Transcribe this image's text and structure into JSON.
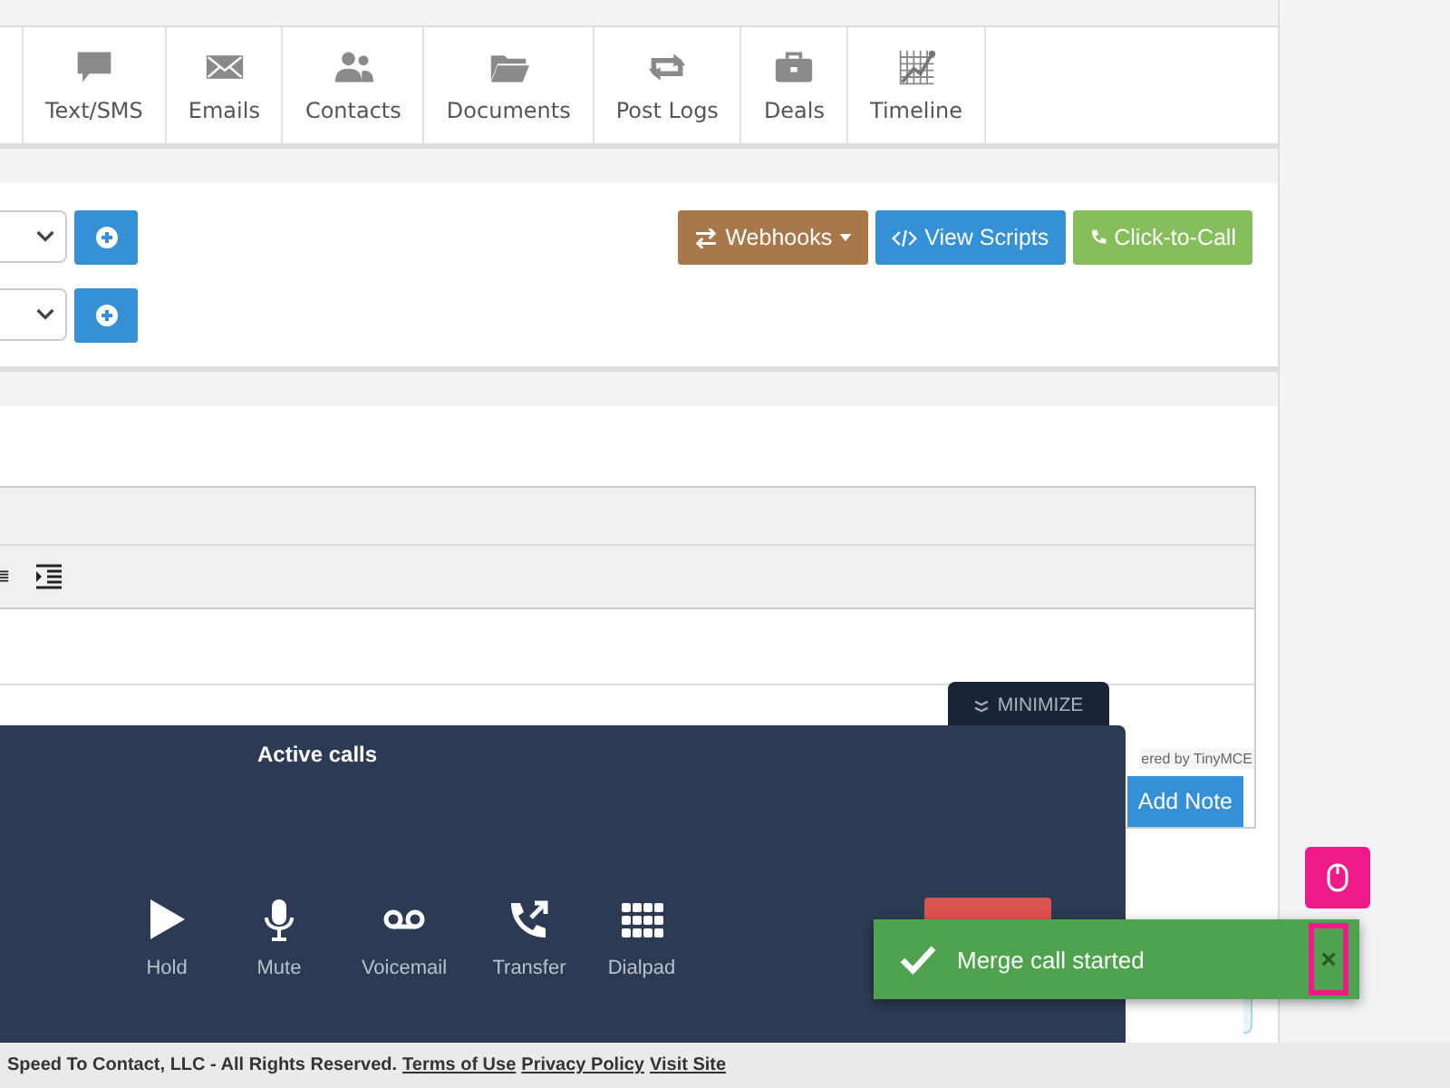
{
  "tabs": [
    {
      "label": "Text/SMS",
      "kind": "chat"
    },
    {
      "label": "Emails",
      "kind": "mail"
    },
    {
      "label": "Contacts",
      "kind": "people"
    },
    {
      "label": "Documents",
      "kind": "folder"
    },
    {
      "label": "Post Logs",
      "kind": "loop"
    },
    {
      "label": "Deals",
      "kind": "case"
    },
    {
      "label": "Timeline",
      "kind": "graph"
    }
  ],
  "actions": [
    {
      "label": "Webhooks",
      "kind": "webhooks"
    },
    {
      "label": "View Scripts",
      "kind": "scripts"
    },
    {
      "label": "Click-to-Call",
      "kind": "call"
    }
  ],
  "editor": {
    "status": "ered by TinyMCE",
    "submit": "Add Note"
  },
  "call_panel": {
    "minimize": "MINIMIZE",
    "title": "Active calls",
    "controls": [
      {
        "label": "Hold",
        "kind": "play"
      },
      {
        "label": "Mute",
        "kind": "mic"
      },
      {
        "label": "Voicemail",
        "kind": "voicemail"
      },
      {
        "label": "Transfer",
        "kind": "transfer"
      },
      {
        "label": "Dialpad",
        "kind": "dialpad"
      }
    ]
  },
  "toast": {
    "message": "Merge call started",
    "close": "×"
  },
  "footer": {
    "text": "Speed To Contact, LLC - All Rights Reserved.",
    "links": [
      "Terms of Use",
      "Privacy Policy",
      "Visit Site"
    ]
  }
}
